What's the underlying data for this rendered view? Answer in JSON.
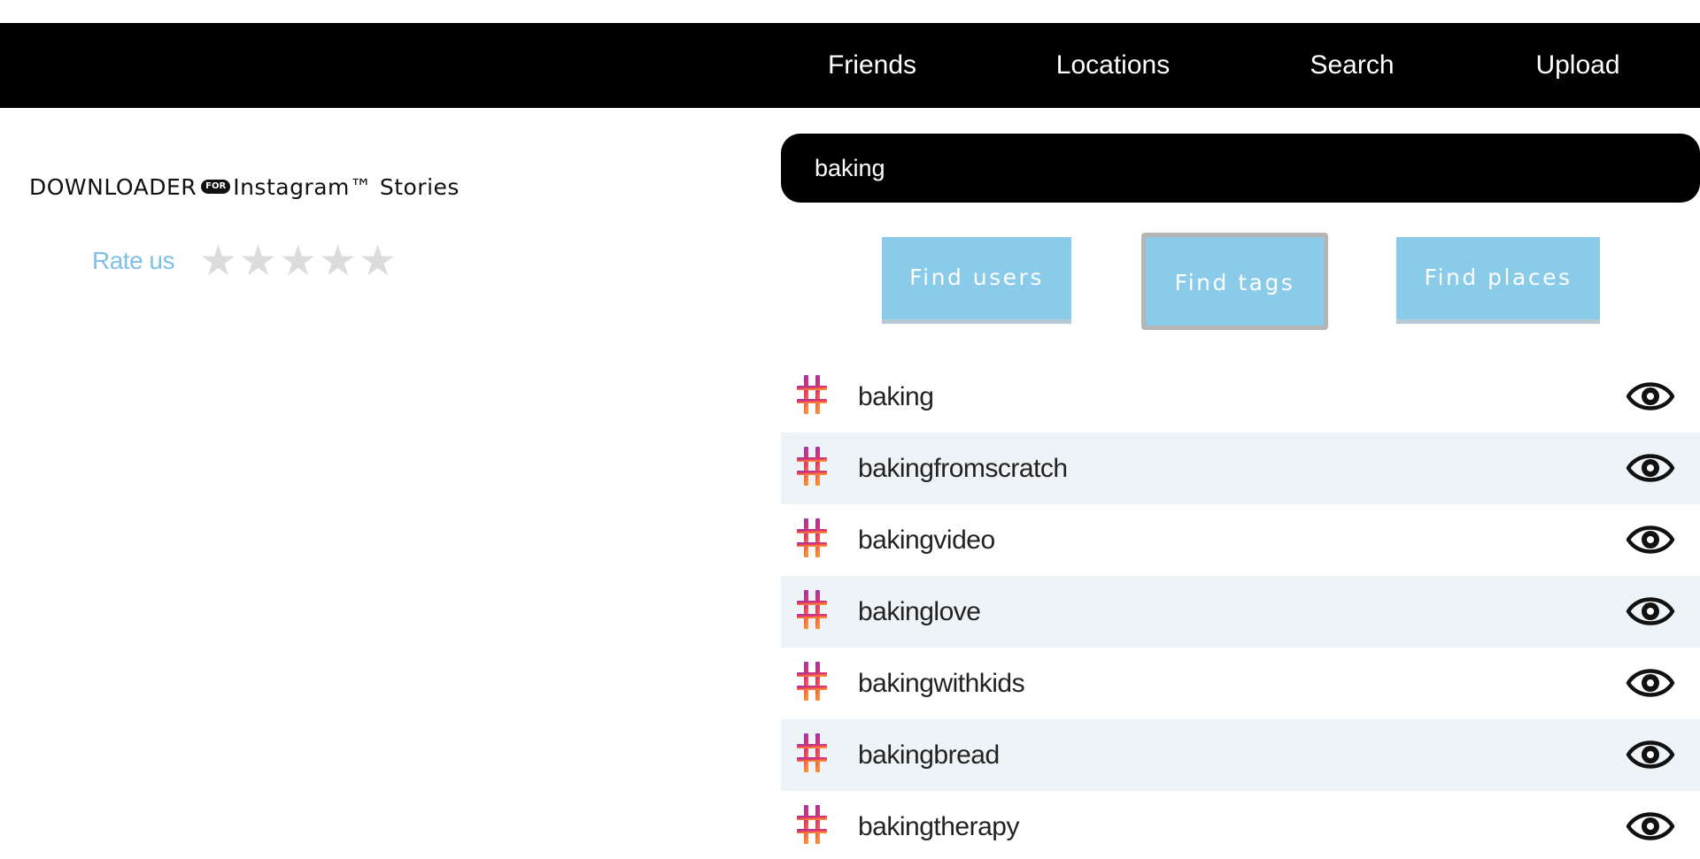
{
  "nav": {
    "items": [
      {
        "label": "Friends"
      },
      {
        "label": "Locations"
      },
      {
        "label": "Search"
      },
      {
        "label": "Upload"
      }
    ]
  },
  "brand": {
    "left": "DOWNLOADER",
    "pill": "FOR",
    "right": "Instagram™ Stories"
  },
  "rating": {
    "label": "Rate us",
    "stars_filled": 0,
    "stars_total": 5
  },
  "search": {
    "value": "baking"
  },
  "buttons": {
    "find_users": "Find users",
    "find_tags": "Find tags",
    "find_places": "Find places",
    "selected": "find_tags"
  },
  "tags": [
    {
      "label": "baking"
    },
    {
      "label": "bakingfromscratch"
    },
    {
      "label": "bakingvideo"
    },
    {
      "label": "bakinglove"
    },
    {
      "label": "bakingwithkids"
    },
    {
      "label": "bakingbread"
    },
    {
      "label": "bakingtherapy"
    }
  ],
  "colors": {
    "nav_bg": "#000000",
    "button_bg": "#89cbe9",
    "rate_label": "#7fbfe8",
    "row_alt_bg": "#eef3f8",
    "star_empty": "#dcdcdc"
  },
  "icons": {
    "tag": "hashtag-icon",
    "view": "eye-icon",
    "rating": "star-icon"
  }
}
